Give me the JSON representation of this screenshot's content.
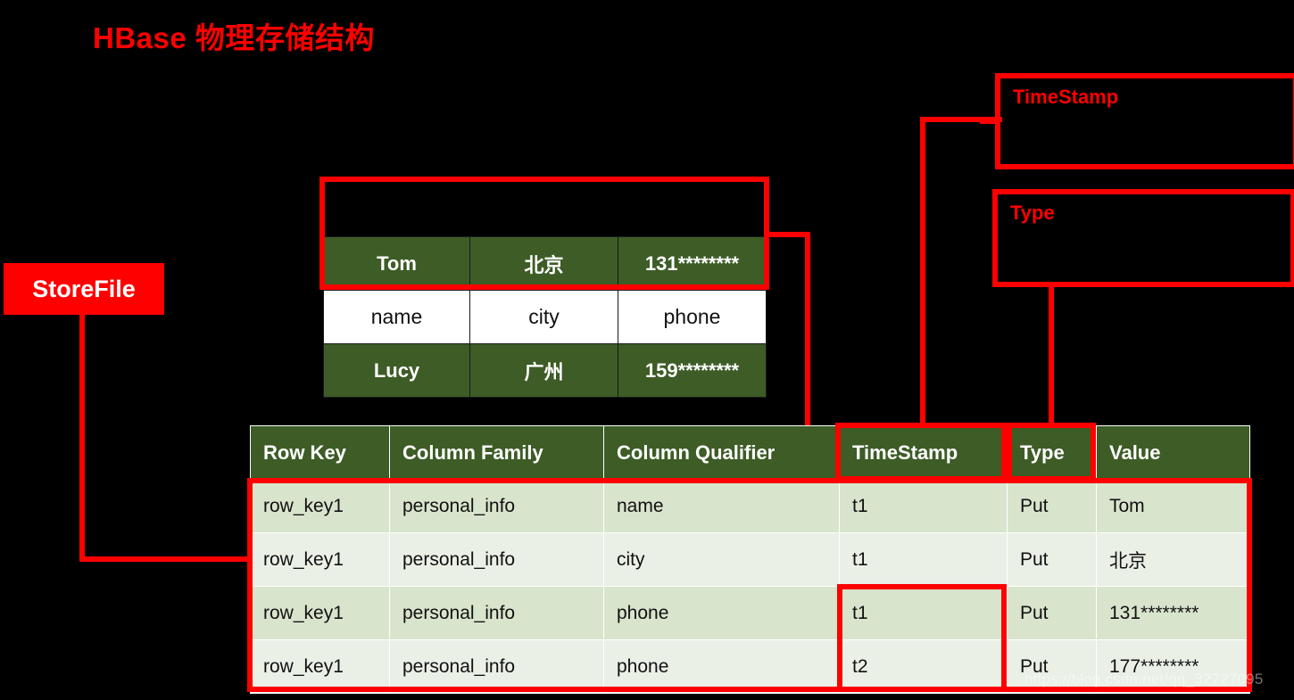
{
  "page": {
    "title": "HBase 物理存储结构",
    "watermark": "https://blog.csdn.net/qq_32727095",
    "colors": {
      "background": "#000000",
      "accent_red": "#ff0000",
      "header_green": "#3d5c26",
      "row_band_a": "#d8e4cc",
      "row_band_b": "#eaf0e6",
      "white": "#ffffff"
    }
  },
  "annotations": {
    "storefile": {
      "label": "StoreFile",
      "style": "filled-red"
    },
    "timestamp": {
      "label": "TimeStamp",
      "style": "outline-red"
    },
    "type": {
      "label": "Type",
      "style": "outline-red"
    }
  },
  "upper_table": {
    "rows": [
      {
        "band": "dark",
        "cells": [
          "Tom",
          "北京",
          "131********"
        ]
      },
      {
        "band": "light",
        "cells": [
          "name",
          "city",
          "phone"
        ]
      },
      {
        "band": "dark",
        "cells": [
          "Lucy",
          "广州",
          "159********"
        ]
      }
    ]
  },
  "main_table": {
    "headers": [
      "Row Key",
      "Column Family",
      "Column Qualifier",
      "TimeStamp",
      "Type",
      "Value"
    ],
    "rows": [
      {
        "row_key": "row_key1",
        "column_family": "personal_info",
        "column_qualifier": "name",
        "timestamp": "t1",
        "type": "Put",
        "value": "Tom"
      },
      {
        "row_key": "row_key1",
        "column_family": "personal_info",
        "column_qualifier": "city",
        "timestamp": "t1",
        "type": "Put",
        "value": "北京"
      },
      {
        "row_key": "row_key1",
        "column_family": "personal_info",
        "column_qualifier": "phone",
        "timestamp": "t1",
        "type": "Put",
        "value": "131********"
      },
      {
        "row_key": "row_key1",
        "column_family": "personal_info",
        "column_qualifier": "phone",
        "timestamp": "t2",
        "type": "Put",
        "value": "177********"
      }
    ]
  }
}
